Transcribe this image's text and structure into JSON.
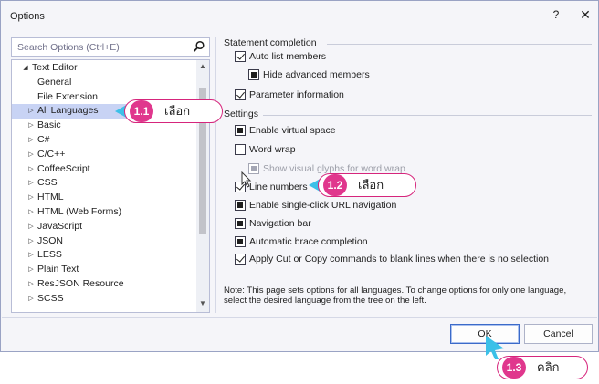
{
  "window": {
    "title": "Options",
    "help_glyph": "?",
    "close_glyph": "✕"
  },
  "search": {
    "placeholder": "Search Options (Ctrl+E)",
    "value": ""
  },
  "tree": {
    "items": [
      {
        "label": "Text Editor",
        "level": 0,
        "arrow": "◢",
        "selected": false
      },
      {
        "label": "General",
        "level": 1,
        "arrow": "",
        "selected": false
      },
      {
        "label": "File Extension",
        "level": 1,
        "arrow": "",
        "selected": false
      },
      {
        "label": "All Languages",
        "level": 1,
        "arrow": "▷",
        "selected": true
      },
      {
        "label": "Basic",
        "level": 1,
        "arrow": "▷",
        "selected": false
      },
      {
        "label": "C#",
        "level": 1,
        "arrow": "▷",
        "selected": false
      },
      {
        "label": "C/C++",
        "level": 1,
        "arrow": "▷",
        "selected": false
      },
      {
        "label": "CoffeeScript",
        "level": 1,
        "arrow": "▷",
        "selected": false
      },
      {
        "label": "CSS",
        "level": 1,
        "arrow": "▷",
        "selected": false
      },
      {
        "label": "HTML",
        "level": 1,
        "arrow": "▷",
        "selected": false
      },
      {
        "label": "HTML (Web Forms)",
        "level": 1,
        "arrow": "▷",
        "selected": false
      },
      {
        "label": "JavaScript",
        "level": 1,
        "arrow": "▷",
        "selected": false
      },
      {
        "label": "JSON",
        "level": 1,
        "arrow": "▷",
        "selected": false
      },
      {
        "label": "LESS",
        "level": 1,
        "arrow": "▷",
        "selected": false
      },
      {
        "label": "Plain Text",
        "level": 1,
        "arrow": "▷",
        "selected": false
      },
      {
        "label": "ResJSON Resource",
        "level": 1,
        "arrow": "▷",
        "selected": false
      },
      {
        "label": "SCSS",
        "level": 1,
        "arrow": "▷",
        "selected": false
      }
    ]
  },
  "statement_completion": {
    "heading": "Statement completion",
    "auto_list": "Auto list members",
    "hide_advanced": "Hide advanced members",
    "parameter_info": "Parameter information"
  },
  "settings": {
    "heading": "Settings",
    "virtual_space": "Enable virtual space",
    "word_wrap": "Word wrap",
    "visual_glyphs": "Show visual glyphs for word wrap",
    "line_numbers": "Line numbers",
    "single_click_url": "Enable single-click URL navigation",
    "navigation_bar": "Navigation bar",
    "brace_completion": "Automatic brace completion",
    "cut_copy_blank": "Apply Cut or Copy commands to blank lines when there is no selection"
  },
  "note": "Note: This page sets options for all languages. To change options for only one language, select the desired language from the tree on the left.",
  "buttons": {
    "ok": "OK",
    "cancel": "Cancel"
  },
  "callouts": [
    {
      "number": "1.1",
      "text": "เลือก"
    },
    {
      "number": "1.2",
      "text": "เลือก"
    },
    {
      "number": "1.3",
      "text": "คลิก"
    }
  ],
  "colors": {
    "accent_magenta": "#e0378d",
    "pointer_cyan": "#3bc0e8",
    "selection": "#c8d3f4",
    "ok_border": "#3b6ac9"
  }
}
